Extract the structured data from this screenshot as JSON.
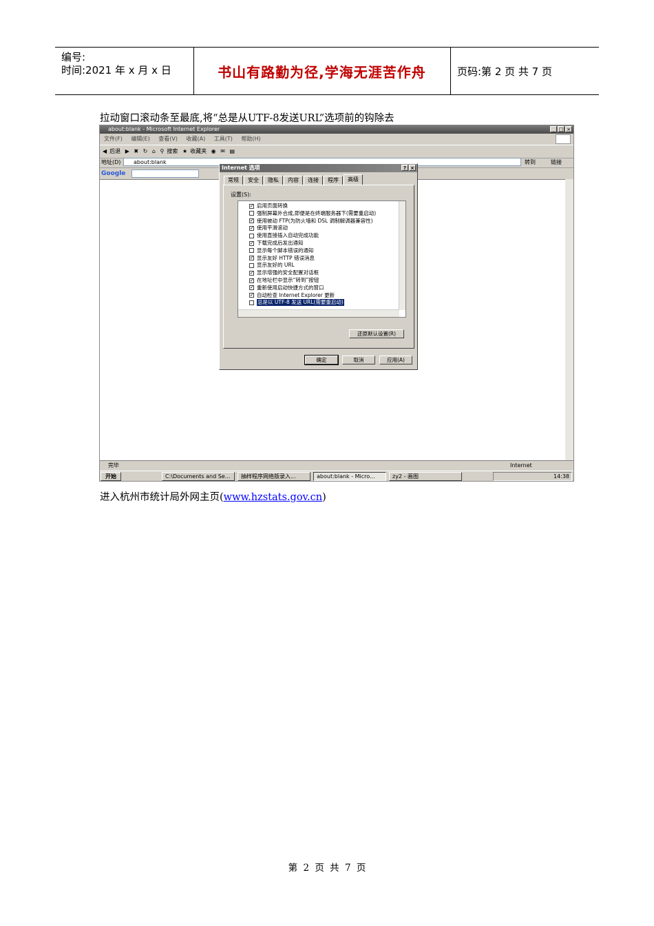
{
  "header": {
    "serial_label": "编号:",
    "time_label": "时间:2021 年 x 月 x 日",
    "motto": "书山有路勤为径,学海无涯苦作舟",
    "page_label": "页码:第 2 页 共 7 页"
  },
  "instruction_1": "拉动窗口滚动条至最底,将“总是从UTF-8发送URL”选项前的钩除去",
  "instruction_2_prefix": "进入杭州市统计局外网主页(",
  "instruction_2_link": "www.hzstats.gov.cn",
  "instruction_2_suffix": ")",
  "screenshot": {
    "window_title": "about:blank - Microsoft Internet Explorer",
    "menu": [
      "文件(F)",
      "编辑(E)",
      "查看(V)",
      "收藏(A)",
      "工具(T)",
      "帮助(H)"
    ],
    "toolbar": {
      "back": "后退",
      "search": "搜索",
      "favorites": "收藏夹"
    },
    "address": {
      "label": "地址(D)",
      "value": "about:blank",
      "go": "转到",
      "links": "链接"
    },
    "google": "Google",
    "status_left": "完毕",
    "status_right": "Internet",
    "taskbar": {
      "start": "开始",
      "items": [
        "C:\\Documents and Se...",
        "抽样程序网络版录入...",
        "about:blank - Micro...",
        "zy2 - 画图"
      ],
      "clock": "14:38"
    },
    "dialog": {
      "title": "Internet 选项",
      "tabs": [
        "常规",
        "安全",
        "隐私",
        "内容",
        "连接",
        "程序",
        "高级"
      ],
      "settings_label": "设置(S):",
      "items": [
        {
          "label": "启用页面转换",
          "checked": true
        },
        {
          "label": "强制屏幕外合成,即便是在终端服务器下(需要重启动)",
          "checked": false
        },
        {
          "label": "使用被动 FTP(为防火墙和 DSL 调制解调器兼容性)",
          "checked": true
        },
        {
          "label": "使用平滑滚动",
          "checked": true
        },
        {
          "label": "使用直接插入自动完成功能",
          "checked": false
        },
        {
          "label": "下载完成后发出通知",
          "checked": true
        },
        {
          "label": "显示每个脚本错误的通知",
          "checked": false
        },
        {
          "label": "显示友好 HTTP 错误消息",
          "checked": true
        },
        {
          "label": "显示友好的 URL",
          "checked": false
        },
        {
          "label": "显示增强的安全配置对话框",
          "checked": true
        },
        {
          "label": "在地址栏中显示“转到”按钮",
          "checked": true
        },
        {
          "label": "重新使用启动快捷方式的窗口",
          "checked": true
        },
        {
          "label": "自动检查 Internet Explorer 更新",
          "checked": true
        },
        {
          "label": "总是以 UTF-8 发送 URL(需要重启动)",
          "checked": false
        }
      ],
      "restore_button": "还原默认设置(R)",
      "ok": "确定",
      "cancel": "取消",
      "apply": "应用(A)"
    }
  },
  "footer": {
    "di": "第",
    "page": "2",
    "ye1": "页",
    "gong": "共",
    "total": "7",
    "ye2": "页"
  }
}
